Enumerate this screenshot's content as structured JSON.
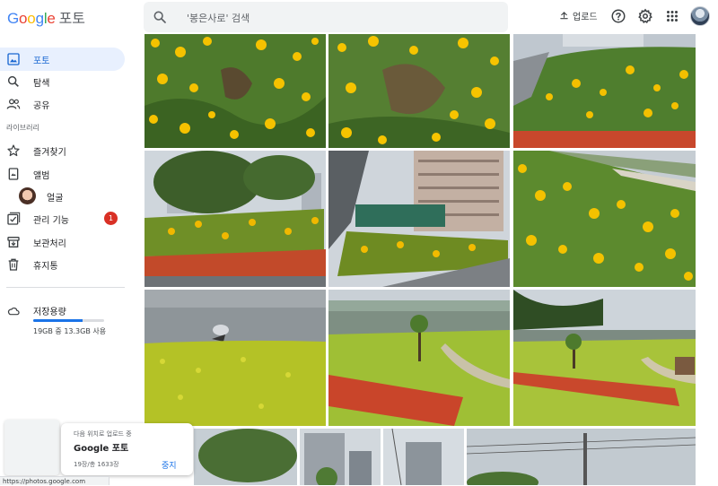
{
  "app": {
    "logo_brand": "Google",
    "logo_product": "포토",
    "brand_colors": [
      "#4285f4",
      "#ea4335",
      "#fbbc05",
      "#4285f4",
      "#34a853",
      "#ea4335"
    ]
  },
  "search": {
    "placeholder": "'봉은사로' 검색",
    "icon": "search-icon"
  },
  "header": {
    "upload_label": "업로드",
    "icons": [
      "upload-icon",
      "help-icon",
      "settings-icon",
      "apps-grid-icon",
      "account-avatar"
    ]
  },
  "sidebar": {
    "items": [
      {
        "label": "포토",
        "icon": "photo-icon",
        "active": true
      },
      {
        "label": "탐색",
        "icon": "search-icon"
      },
      {
        "label": "공유",
        "icon": "people-icon"
      }
    ],
    "library_label": "라이브러리",
    "library_items": [
      {
        "label": "즐겨찾기",
        "icon": "star-icon"
      },
      {
        "label": "앨범",
        "icon": "album-icon"
      },
      {
        "label": "얼굴",
        "icon": "face-avatar"
      },
      {
        "label": "관리 기능",
        "icon": "utilities-icon",
        "badge": "1"
      },
      {
        "label": "보관처리",
        "icon": "archive-icon"
      },
      {
        "label": "휴지통",
        "icon": "trash-icon"
      }
    ],
    "storage": {
      "label": "저장용량",
      "usage_text": "19GB 중 13.3GB 사용",
      "used_fraction": 0.7
    }
  },
  "toast": {
    "subtitle": "다음 위치로 업로드 중",
    "title": "Google 포토",
    "progress_text": "19장/총 1633장",
    "stop_label": "중지"
  },
  "status_bar": {
    "url": "https://photos.google.com"
  },
  "colors": {
    "accent": "#1a73e8",
    "active_bg": "#e8f0fe",
    "badge": "#d93025"
  }
}
